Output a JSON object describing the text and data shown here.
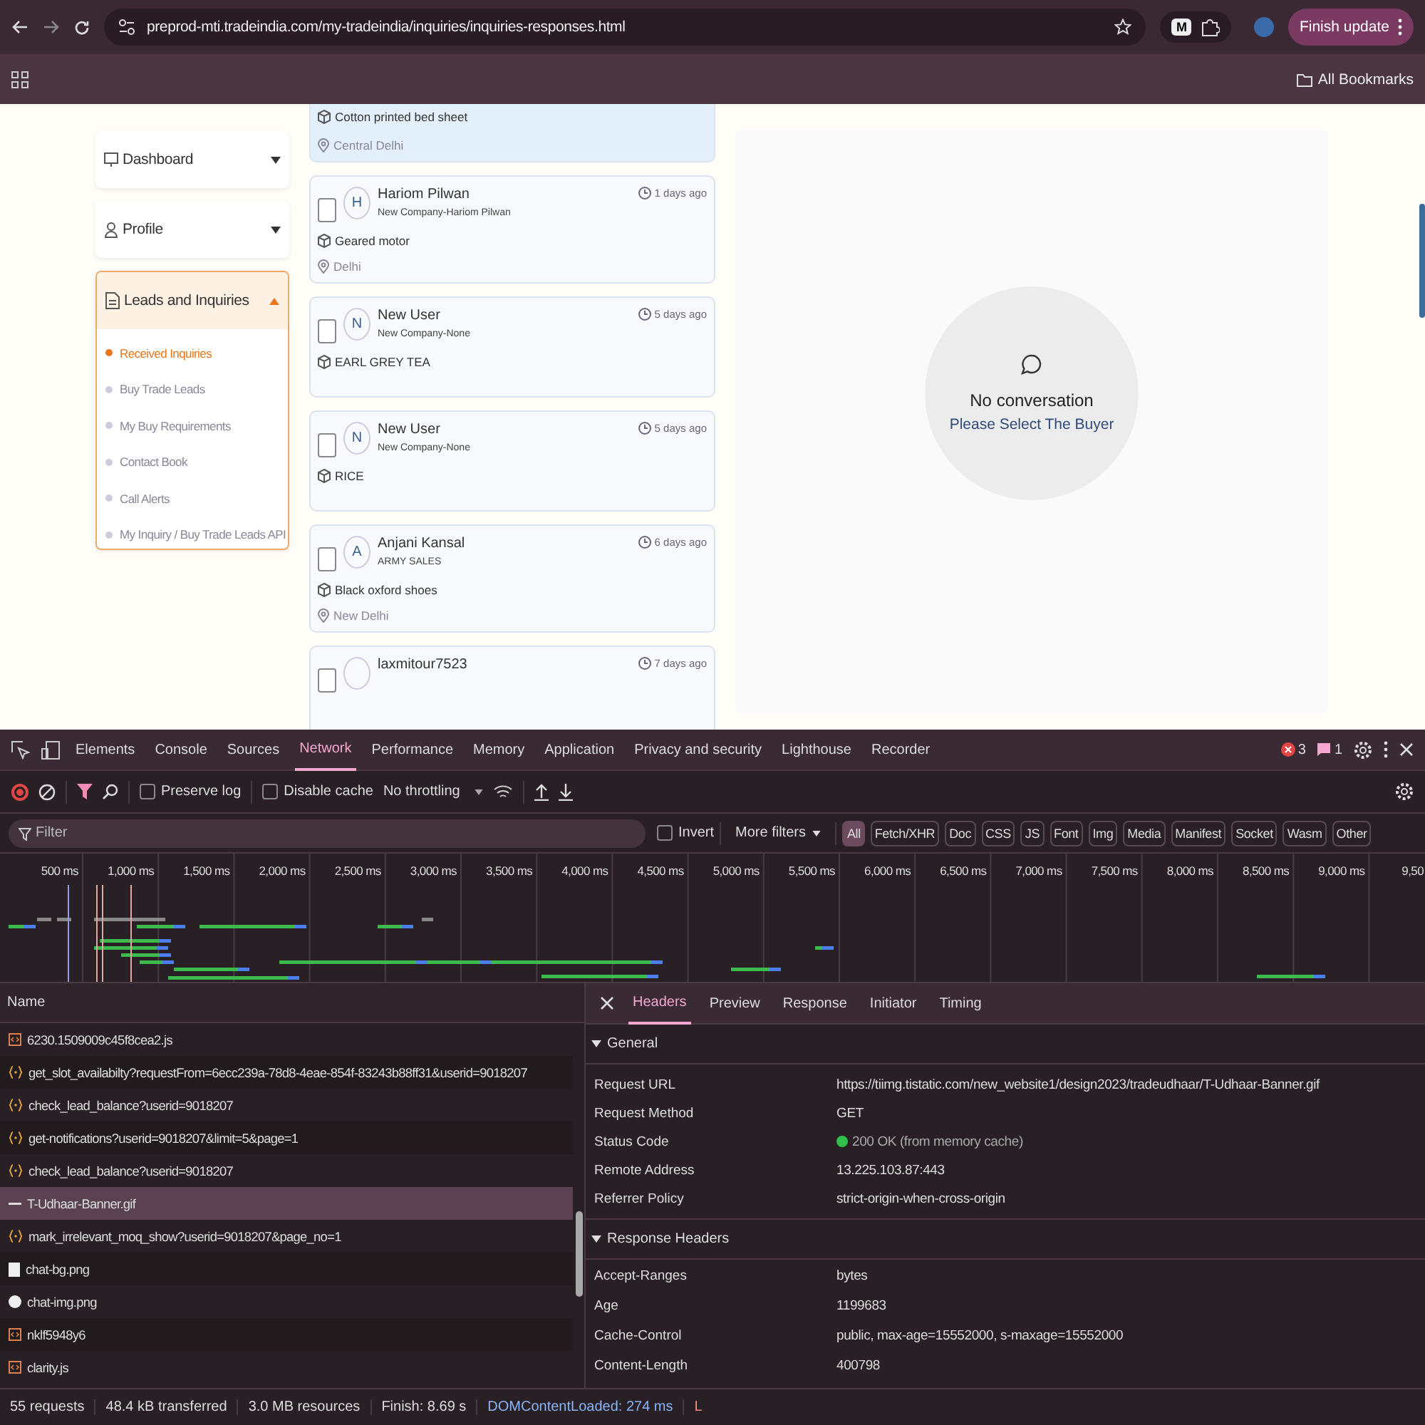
{
  "browser": {
    "url": "preprod-mti.tradeindia.com/my-tradeindia/inquiries/inquiries-responses.html",
    "profile_initial": "M",
    "update_button": "Finish update",
    "bookmarks": "All Bookmarks"
  },
  "sidebar": [
    {
      "label": "Dashboard",
      "expanded": false
    },
    {
      "label": "Profile",
      "expanded": false
    },
    {
      "label": "Leads and Inquiries",
      "expanded": true,
      "items": [
        {
          "label": "Received Inquiries",
          "selected": true
        },
        {
          "label": "Buy Trade Leads",
          "selected": false
        },
        {
          "label": "My Buy Requirements",
          "selected": false
        },
        {
          "label": "Contact Book",
          "selected": false
        },
        {
          "label": "Call Alerts",
          "selected": false
        },
        {
          "label": "My Inquiry / Buy Trade Leads API",
          "selected": false
        }
      ]
    }
  ],
  "inquiries": [
    {
      "product": "Cotton printed bed sheet",
      "location": "Central Delhi",
      "selected": true
    },
    {
      "name": "Hariom Pilwan",
      "initial": "H",
      "company": "New Company-Hariom Pilwan",
      "time": "1 days ago",
      "product": "Geared motor",
      "location": "Delhi",
      "selected": false,
      "checked": false
    },
    {
      "name": "New User",
      "initial": "N",
      "company": "New Company-None",
      "time": "5 days ago",
      "product": "EARL GREY TEA",
      "selected": false,
      "checked": false
    },
    {
      "name": "New User",
      "initial": "N",
      "company": "New Company-None",
      "time": "5 days ago",
      "product": "RICE",
      "selected": false,
      "checked": false
    },
    {
      "name": "Anjani Kansal",
      "initial": "A",
      "company": "ARMY SALES",
      "time": "6 days ago",
      "product": "Black oxford shoes",
      "location": "New Delhi",
      "selected": false,
      "checked": false
    },
    {
      "name": "laxmitour7523",
      "time": "7 days ago",
      "selected": false,
      "checked": false
    }
  ],
  "chat": {
    "title": "No conversation",
    "subtitle": "Please Select The Buyer"
  },
  "devtools": {
    "tabs": [
      {
        "label": "Elements",
        "selected": false
      },
      {
        "label": "Console",
        "selected": false
      },
      {
        "label": "Sources",
        "selected": false
      },
      {
        "label": "Network",
        "selected": true
      },
      {
        "label": "Performance",
        "selected": false
      },
      {
        "label": "Memory",
        "selected": false
      },
      {
        "label": "Application",
        "selected": false
      },
      {
        "label": "Privacy and security",
        "selected": false
      },
      {
        "label": "Lighthouse",
        "selected": false
      },
      {
        "label": "Recorder",
        "selected": false
      }
    ],
    "errors": "3",
    "messages": "1",
    "toolbar": {
      "preserve_log": false,
      "disable_cache": false,
      "preserve_label": "Preserve log",
      "cache_label": "Disable cache",
      "throttling": "No throttling"
    },
    "filter": {
      "placeholder": "Filter",
      "invert": false,
      "invert_label": "Invert",
      "more_filters": "More filters",
      "types": [
        {
          "label": "All",
          "selected": true
        },
        {
          "label": "Fetch/XHR",
          "selected": false
        },
        {
          "label": "Doc",
          "selected": false
        },
        {
          "label": "CSS",
          "selected": false
        },
        {
          "label": "JS",
          "selected": false
        },
        {
          "label": "Font",
          "selected": false
        },
        {
          "label": "Img",
          "selected": false
        },
        {
          "label": "Media",
          "selected": false
        },
        {
          "label": "Manifest",
          "selected": false
        },
        {
          "label": "Socket",
          "selected": false
        },
        {
          "label": "Wasm",
          "selected": false
        },
        {
          "label": "Other",
          "selected": false
        }
      ]
    },
    "overview_ticks": [
      "500 ms",
      "1,000 ms",
      "1,500 ms",
      "2,000 ms",
      "2,500 ms",
      "3,000 ms",
      "3,500 ms",
      "4,000 ms",
      "4,500 ms",
      "5,000 ms",
      "5,500 ms",
      "6,000 ms",
      "6,500 ms",
      "7,000 ms",
      "7,500 ms",
      "8,000 ms",
      "8,500 ms",
      "9,000 ms",
      "9,50"
    ],
    "requests": {
      "column": "Name",
      "rows": [
        {
          "name": "6230.1509009c45f8cea2.js",
          "kind": "script",
          "selected": false
        },
        {
          "name": "get_slot_availabilty?requestFrom=6ecc239a-78d8-4eae-854f-83243b88ff31&userid=9018207",
          "kind": "fetch",
          "selected": false
        },
        {
          "name": "check_lead_balance?userid=9018207",
          "kind": "fetch",
          "selected": false
        },
        {
          "name": "get-notifications?userid=9018207&limit=5&page=1",
          "kind": "fetch",
          "selected": false
        },
        {
          "name": "check_lead_balance?userid=9018207",
          "kind": "fetch",
          "selected": false
        },
        {
          "name": "T-Udhaar-Banner.gif",
          "kind": "gif",
          "selected": true
        },
        {
          "name": "mark_irrelevant_moq_show?userid=9018207&page_no=1",
          "kind": "fetch",
          "selected": false
        },
        {
          "name": "chat-bg.png",
          "kind": "image",
          "selected": false
        },
        {
          "name": "chat-img.png",
          "kind": "image-round",
          "selected": false
        },
        {
          "name": "nklf5948y6",
          "kind": "script",
          "selected": false
        },
        {
          "name": "clarity.js",
          "kind": "script",
          "selected": false
        }
      ]
    },
    "details": {
      "tabs": [
        {
          "label": "Headers",
          "selected": true
        },
        {
          "label": "Preview",
          "selected": false
        },
        {
          "label": "Response",
          "selected": false
        },
        {
          "label": "Initiator",
          "selected": false
        },
        {
          "label": "Timing",
          "selected": false
        }
      ],
      "sections": [
        {
          "title": "General",
          "expanded": true,
          "rows": [
            {
              "name": "Request URL",
              "value": "https://tiimg.tistatic.com/new_website1/design2023/tradeudhaar/T-Udhaar-Banner.gif",
              "kind": "text"
            },
            {
              "name": "Request Method",
              "value": "GET",
              "kind": "text"
            },
            {
              "name": "Status Code",
              "value": "200 OK (from memory cache)",
              "kind": "status",
              "color": "#2fbf4a"
            },
            {
              "name": "Remote Address",
              "value": "13.225.103.87:443",
              "kind": "text"
            },
            {
              "name": "Referrer Policy",
              "value": "strict-origin-when-cross-origin",
              "kind": "text"
            }
          ]
        },
        {
          "title": "Response Headers",
          "expanded": true,
          "rows": [
            {
              "name": "Accept-Ranges",
              "value": "bytes",
              "kind": "text"
            },
            {
              "name": "Age",
              "value": "1199683",
              "kind": "text"
            },
            {
              "name": "Cache-Control",
              "value": "public, max-age=15552000, s-maxage=15552000",
              "kind": "text"
            },
            {
              "name": "Content-Length",
              "value": "400798",
              "kind": "text"
            }
          ]
        }
      ]
    },
    "status_bar": [
      {
        "text": "55 requests",
        "kind": "plain"
      },
      {
        "text": "48.4 kB transferred",
        "kind": "plain"
      },
      {
        "text": "3.0 MB resources",
        "kind": "plain"
      },
      {
        "text": "Finish: 8.69 s",
        "kind": "plain"
      },
      {
        "text": "DOMContentLoaded: 274 ms",
        "kind": "dcl"
      },
      {
        "text": "L",
        "kind": "load"
      }
    ]
  }
}
